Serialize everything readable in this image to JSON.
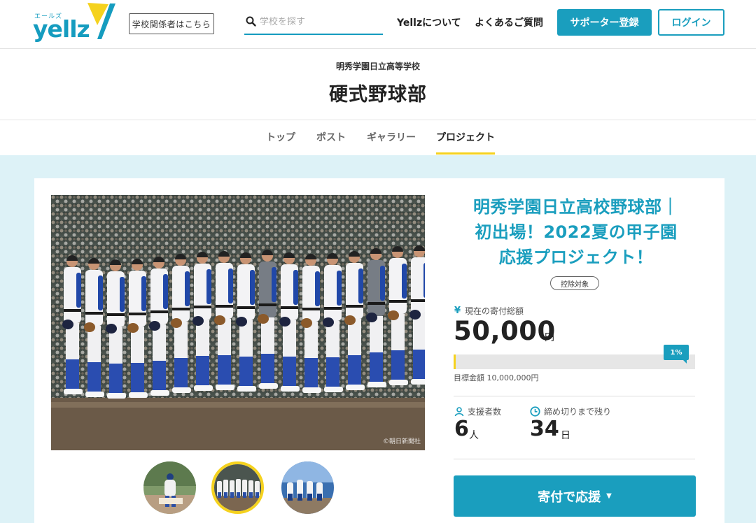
{
  "header": {
    "logo_kana": "エールズ",
    "logo_word": "yellz",
    "staff_button": "学校関係者はこちら",
    "search_placeholder": "学校を探す",
    "nav_about": "Yellzについて",
    "nav_faq": "よくあるご質問",
    "supporter_button": "サポーター登録",
    "login_button": "ログイン"
  },
  "school": {
    "school_name": "明秀学園日立高等学校",
    "club_name": "硬式野球部"
  },
  "tabs": [
    {
      "label": "トップ"
    },
    {
      "label": "ポスト"
    },
    {
      "label": "ギャラリー"
    },
    {
      "label": "プロジェクト"
    }
  ],
  "project": {
    "photo_credit": "©朝日新聞社",
    "title_lines": [
      "明秀学園日立高校野球部｜",
      "初出場！2022夏の甲子園",
      "応援プロジェクト！"
    ],
    "tax_badge": "控除対象",
    "amount_label": "現在の寄付総額",
    "amount_currency_icon": "¥",
    "amount": "50,000",
    "amount_unit": "円",
    "progress_percent_label": "1%",
    "progress_fraction": 0.005,
    "goal_label": "目標金額 10,000,000円",
    "supporters_label": "支援者数",
    "supporters_value": "6",
    "supporters_unit": "人",
    "deadline_label": "締め切りまで残り",
    "deadline_value": "34",
    "deadline_unit": "日",
    "donate_button": "寄付で応援",
    "donate_caret": "▼"
  },
  "colors": {
    "accent": "#1a9ebe",
    "highlight": "#f5d21e",
    "main_bg": "#ddf2f7"
  }
}
